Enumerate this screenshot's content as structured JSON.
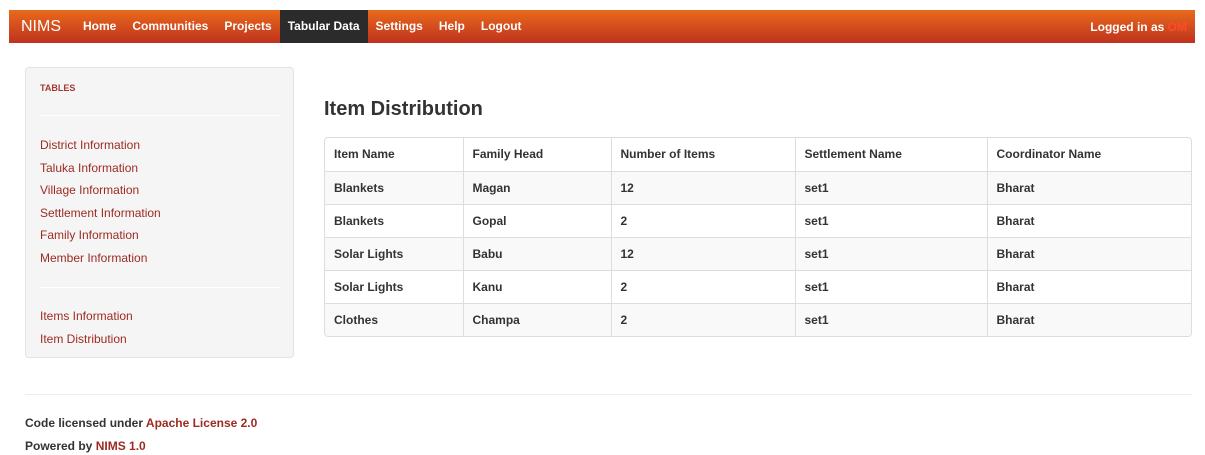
{
  "navbar": {
    "brand": "NIMS",
    "items": [
      {
        "label": "Home"
      },
      {
        "label": "Communities"
      },
      {
        "label": "Projects"
      },
      {
        "label": "Tabular Data"
      },
      {
        "label": "Settings"
      },
      {
        "label": "Help"
      },
      {
        "label": "Logout"
      }
    ],
    "logged_in_prefix": "Logged in as",
    "user": "OM"
  },
  "sidebar": {
    "header": "TABLES",
    "group1": [
      {
        "label": "District Information"
      },
      {
        "label": "Taluka Information"
      },
      {
        "label": "Village Information"
      },
      {
        "label": "Settlement Information"
      },
      {
        "label": "Family Information"
      },
      {
        "label": "Member Information"
      }
    ],
    "group2": [
      {
        "label": "Items Information"
      },
      {
        "label": "Item Distribution"
      }
    ]
  },
  "main": {
    "title": "Item Distribution",
    "columns": [
      "Item Name",
      "Family Head",
      "Number of Items",
      "Settlement Name",
      "Coordinator Name"
    ],
    "rows": [
      [
        "Blankets",
        "Magan",
        "12",
        "set1",
        "Bharat"
      ],
      [
        "Blankets",
        "Gopal",
        "2",
        "set1",
        "Bharat"
      ],
      [
        "Solar Lights",
        "Babu",
        "12",
        "set1",
        "Bharat"
      ],
      [
        "Solar Lights",
        "Kanu",
        "2",
        "set1",
        "Bharat"
      ],
      [
        "Clothes",
        "Champa",
        "2",
        "set1",
        "Bharat"
      ]
    ]
  },
  "footer": {
    "license_prefix": "Code licensed under",
    "license_link": "Apache License 2.0",
    "powered_prefix": "Powered by",
    "powered_link": "NIMS 1.0"
  }
}
